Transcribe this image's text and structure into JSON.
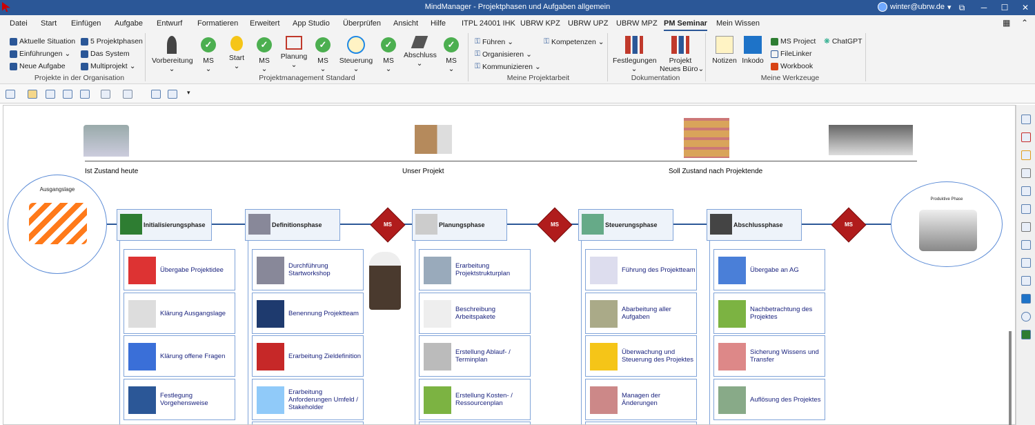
{
  "window": {
    "title": "MindManager - Projektphasen und Aufgaben allgemein",
    "user": "winter@ubrw.de"
  },
  "menu": [
    "Datei",
    "Start",
    "Einfügen",
    "Aufgabe",
    "Entwurf",
    "Formatieren",
    "Erweitert",
    "App Studio",
    "Überprüfen",
    "Ansicht",
    "Hilfe",
    "ITPL 24001 IHK",
    "UBRW KPZ",
    "UBRW UPZ",
    "UBRW MPZ",
    "PM Seminar",
    "Mein Wissen"
  ],
  "ribbon": {
    "org": {
      "items": [
        "Aktuelle Situation",
        "Einführungen",
        "Neue Aufgabe",
        "5 Projektphasen",
        "Das System",
        "Multiprojekt"
      ],
      "label": "Projekte in der Organisation"
    },
    "std": {
      "buttons": [
        "Vorbereitung",
        "MS",
        "Start",
        "MS",
        "Planung",
        "MS",
        "Steuerung",
        "MS",
        "Abschluss",
        "MS"
      ],
      "label": "Projektmanagement Standard"
    },
    "arbeit": {
      "items": [
        "Führen",
        "Organisieren",
        "Kommunizieren",
        "Kompetenzen"
      ],
      "label": "Meine Projektarbeit"
    },
    "doku": {
      "buttons": [
        "Festlegungen",
        "Projekt",
        "Neues Büro"
      ],
      "label": "Dokumentation"
    },
    "werk": {
      "buttons": [
        "Notizen",
        "Inkodo"
      ],
      "items": [
        "MS Project",
        "FileLinker",
        "Workbook",
        "ChatGPT"
      ],
      "label": "Meine Werkzeuge"
    }
  },
  "map": {
    "top": {
      "left": "Ist Zustand heute",
      "center": "Unser Projekt",
      "right": "Soll Zustand nach Projektende"
    },
    "start_circle": "Ausgangslage",
    "end_circle": "Produktive Phase",
    "milestone": "MS",
    "phases": [
      {
        "name": "Initialisierungsphase",
        "tasks": [
          "Übergabe Projektidee",
          "Klärung Ausgangslage",
          "Klärung offene Fragen",
          "Festlegung Vorgehensweise"
        ]
      },
      {
        "name": "Definitionsphase",
        "tasks": [
          "Durchführung Startworkshop",
          "Benennung Projektteam",
          "Erarbeitung Zieldefinition",
          "Erarbeitung Anforderungen Umfeld / Stakeholder"
        ]
      },
      {
        "name": "Planungsphase",
        "tasks": [
          "Erarbeitung Projektstrukturplan",
          "Beschreibung Arbeitspakete",
          "Erstellung Ablauf- / Terminplan",
          "Erstellung Kosten- / Ressourcenplan"
        ]
      },
      {
        "name": "Steuerungsphase",
        "tasks": [
          "Führung des Projektteam",
          "Abarbeitung aller Aufgaben",
          "Überwachung und Steuerung des Projektes",
          "Managen der Änderungen"
        ]
      },
      {
        "name": "Abschlussphase",
        "tasks": [
          "Übergabe an AG",
          "Nachbetrachtung des Projektes",
          "Sicherung Wissens und Transfer",
          "Auflösung des Projektes"
        ]
      }
    ]
  },
  "colors": {
    "titlebar": "#2b5797",
    "milestone": "#b01c1c",
    "task_text": "#1a237e",
    "border": "#7fa3d8"
  }
}
